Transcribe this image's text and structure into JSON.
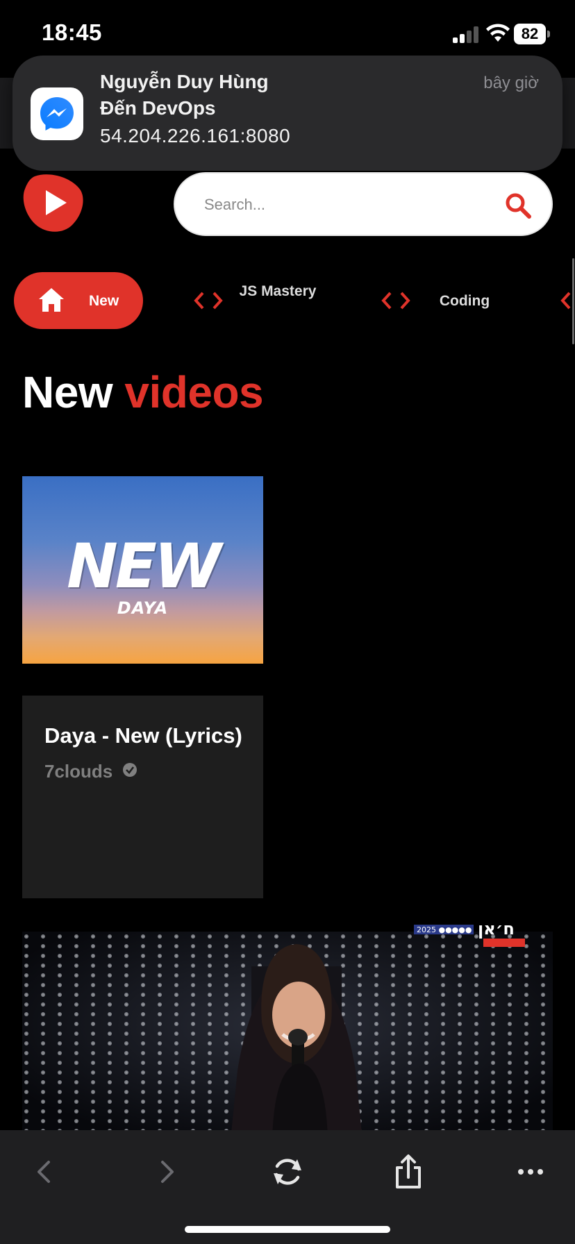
{
  "status_bar": {
    "time": "18:45",
    "battery": "82"
  },
  "notification": {
    "title": "Nguyễn Duy Hùng",
    "subtitle": "Đến DevOps",
    "body": "54.204.226.161:8080",
    "time": "bây giờ",
    "app_icon": "messenger-icon"
  },
  "header": {
    "logo_icon": "play-logo-icon",
    "search": {
      "placeholder": "Search...",
      "value": ""
    }
  },
  "categories": [
    {
      "label": "New",
      "icon": "home-icon",
      "active": true
    },
    {
      "label": "JS Mastery",
      "icon": "code-icon",
      "active": false
    },
    {
      "label": "Coding",
      "icon": "code-icon",
      "active": false
    }
  ],
  "feed": {
    "heading_1": "New",
    "heading_2": "videos"
  },
  "videos": [
    {
      "thumbnail_text": "NEW",
      "thumbnail_subtext": "DAYA",
      "title": "Daya - New (Lyrics)",
      "channel": "7clouds",
      "verified": true
    },
    {
      "title": "",
      "channel": ""
    }
  ],
  "toolbar": {
    "back_icon": "chevron-left-icon",
    "forward_icon": "chevron-right-icon",
    "reload_icon": "reload-icon",
    "share_icon": "share-icon",
    "more_icon": "more-icon"
  },
  "colors": {
    "accent": "#e0332a",
    "card_bg": "#1e1e1e",
    "toolbar_bg": "#1f1f21"
  }
}
